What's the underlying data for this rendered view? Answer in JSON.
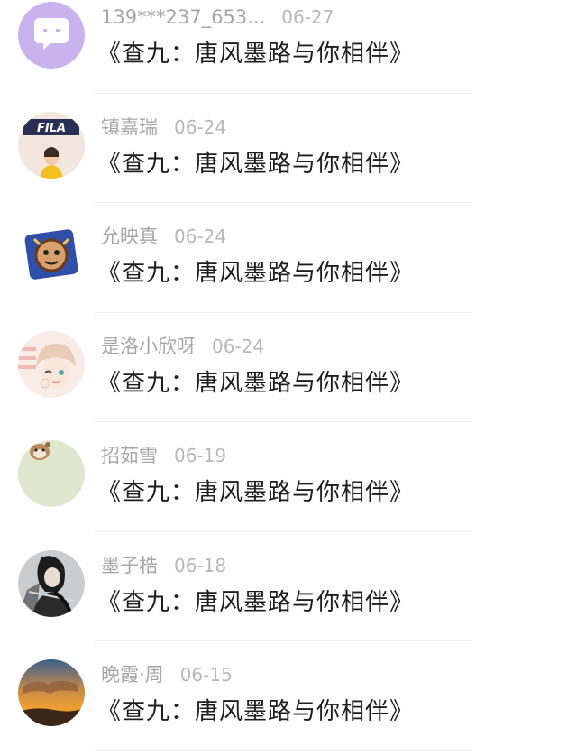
{
  "comments": [
    {
      "name": "139***237_653...",
      "time": "06-27",
      "text": "《查九：唐风墨路与你相伴》",
      "avatar": "chat-bubble-avatar",
      "avatar_color": "#c9b3ee"
    },
    {
      "name": "镇嘉瑞",
      "time": "06-24",
      "text": "《查九：唐风墨路与你相伴》",
      "avatar": "fila-photo-avatar",
      "avatar_color": "#f2e6de"
    },
    {
      "name": "允映真",
      "time": "06-24",
      "text": "《查九：唐风墨路与你相伴》",
      "avatar": "cartoon-badge-avatar",
      "avatar_color": "#2f4fa8"
    },
    {
      "name": "是洛小欣呀",
      "time": "06-24",
      "text": "《查九：唐风墨路与你相伴》",
      "avatar": "anime-girl-avatar",
      "avatar_color": "#f3ddd3"
    },
    {
      "name": "招茹雪",
      "time": "06-19",
      "text": "《查九：唐风墨路与你相伴》",
      "avatar": "hamster-avatar",
      "avatar_color": "#dfe8cf"
    },
    {
      "name": "墨子梏",
      "time": "06-18",
      "text": "《查九：唐风墨路与你相伴》",
      "avatar": "swordsman-avatar",
      "avatar_color": "#8a8f93"
    },
    {
      "name": "晚霞·周",
      "time": "06-15",
      "text": "《查九：唐风墨路与你相伴》",
      "avatar": "sunset-avatar",
      "avatar_color": "#e08a2c"
    }
  ]
}
